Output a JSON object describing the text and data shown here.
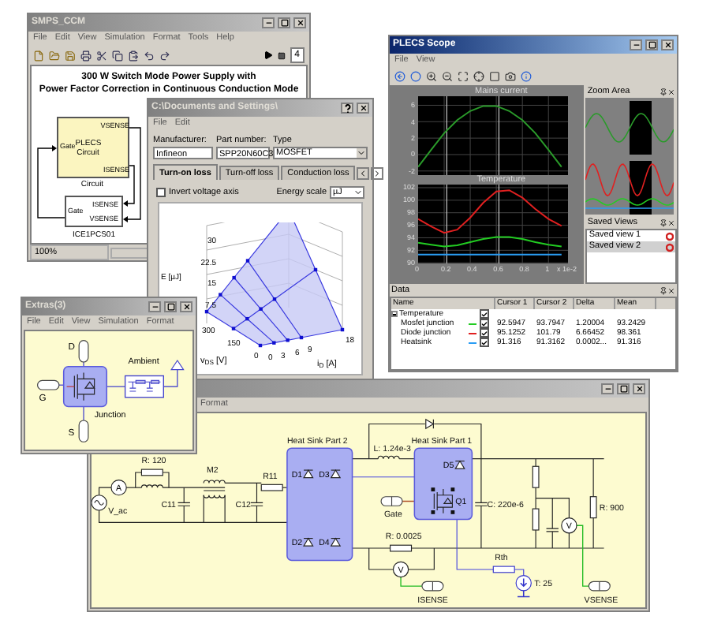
{
  "model_window": {
    "title": "SMPS_CCM",
    "active": false,
    "menu": [
      "File",
      "Edit",
      "View",
      "Simulation",
      "Format",
      "Tools",
      "Help"
    ],
    "step": "4",
    "heading_lines": [
      "300 W Switch Mode Power Supply with",
      "Power Factor Correction in Continuous Conduction Mode"
    ],
    "blocks": [
      {
        "kind": "subsystem",
        "body": "PLECS Circuit",
        "label": "Circuit",
        "port_left": "Gate",
        "ports_right": [
          "VSENSE",
          "ISENSE"
        ]
      },
      {
        "kind": "component",
        "label": "ICE1PCS01",
        "port_left": "Gate",
        "ports_right": [
          "ISENSE",
          "VSENSE"
        ]
      }
    ],
    "status": "100%"
  },
  "loss_window": {
    "title": "C:\\Documents and Settings\\",
    "active": false,
    "menu": [
      "File",
      "Edit"
    ],
    "fields": [
      {
        "kind": "text",
        "label": "Manufacturer:",
        "value": "Infineon"
      },
      {
        "kind": "text",
        "label": "Part number:",
        "value": "SPP20N60C3"
      },
      {
        "kind": "dropdown",
        "label": "Type",
        "value": "MOSFET"
      }
    ],
    "tabs": [
      {
        "label": "Turn-on loss",
        "selected": true
      },
      {
        "label": "Turn-off loss",
        "selected": false
      },
      {
        "label": "Conduction loss",
        "selected": false
      }
    ],
    "invert_axis": {
      "label": "Invert voltage axis",
      "checked": false
    },
    "energy_scale": {
      "label": "Energy scale",
      "value": "µJ"
    },
    "plot": {
      "z_label": "E [µJ]",
      "z_ticks": [
        "30",
        "22.5",
        "15",
        "7.5"
      ],
      "v_label": "v$_{DS}$ [V]",
      "v_ticks": [
        "300",
        "150",
        "0"
      ],
      "i_label": "i$_{D}$ [A]",
      "i_ticks": [
        "0",
        "3",
        "6",
        "9",
        "18"
      ]
    }
  },
  "scope_window": {
    "title": "PLECS Scope",
    "active": true,
    "menu": [
      "File",
      "View"
    ],
    "plots": [
      {
        "chart_data": {
          "type": "line",
          "title": "Mains current",
          "x": [
            0,
            0.1,
            0.2,
            0.3,
            0.4,
            0.5,
            0.6,
            0.7,
            0.8,
            0.9,
            1.0,
            1.1
          ],
          "xlim": [
            0,
            1.15
          ],
          "ylim": [
            -2.5,
            7.1
          ],
          "yticks": [
            -2,
            0,
            2,
            4,
            6
          ],
          "grid": true,
          "ref_lines": [
            {
              "axis": "x",
              "value": 0.22
            },
            {
              "axis": "x",
              "value": 0.62
            }
          ],
          "series": [
            {
              "color": "#2a9a2a",
              "values": [
                -1.5,
                0.6,
                2.6,
                4.2,
                5.3,
                5.9,
                5.9,
                5.3,
                4.2,
                2.6,
                0.6,
                -1.5
              ]
            }
          ]
        }
      },
      {
        "chart_data": {
          "type": "line",
          "title": "Temperature",
          "x": [
            0,
            0.1,
            0.2,
            0.3,
            0.4,
            0.5,
            0.6,
            0.7,
            0.8,
            0.9,
            1.0,
            1.1
          ],
          "xlim": [
            0,
            1.15
          ],
          "ylim": [
            89.9,
            102.5
          ],
          "yticks": [
            90,
            92,
            94,
            96,
            98,
            100,
            102
          ],
          "xticks": [
            0,
            0.2,
            0.4,
            0.6,
            0.8,
            1
          ],
          "xlabel": "x 1e-2",
          "grid": true,
          "ref_lines": [
            {
              "axis": "x",
              "value": 0.22
            },
            {
              "axis": "x",
              "value": 0.62
            }
          ],
          "series": [
            {
              "color": "#22cc22",
              "values": [
                93.2,
                92.9,
                92.6,
                92.8,
                93.3,
                93.8,
                94.1,
                94.1,
                93.8,
                93.3,
                92.9,
                92.6
              ]
            },
            {
              "color": "#e02020",
              "values": [
                97,
                95.8,
                94.8,
                95.3,
                97.2,
                99.6,
                101.4,
                101.6,
                100.4,
                98.6,
                97,
                95.9
              ]
            },
            {
              "color": "#2a9df4",
              "values": [
                91.3,
                91.3,
                91.3,
                91.3,
                91.3,
                91.3,
                91.3,
                91.3,
                91.3,
                91.3,
                91.3,
                91.3
              ]
            }
          ]
        }
      }
    ],
    "zoom_area": {
      "title": "Zoom Area"
    },
    "saved_views": {
      "title": "Saved Views",
      "items": [
        {
          "label": "Saved view 1",
          "selected": false
        },
        {
          "label": "Saved view 2",
          "selected": true
        }
      ]
    },
    "data": {
      "title": "Data",
      "columns": [
        "Name",
        "Cursor 1",
        "Cursor 2",
        "Delta",
        "Mean"
      ],
      "group": {
        "label": "Temperature",
        "checked": true,
        "expanded": true
      },
      "rows": [
        {
          "cells": [
            "Mosfet junction",
            "92.5947",
            "93.7947",
            "1.20004",
            "93.2429"
          ],
          "color": "#22cc22",
          "checked": true
        },
        {
          "cells": [
            "Diode junction",
            "95.1252",
            "101.79",
            "6.66452",
            "98.361"
          ],
          "color": "#e02020",
          "checked": true
        },
        {
          "cells": [
            "Heatsink",
            "91.316",
            "91.3162",
            "0.0002...",
            "91.316"
          ],
          "color": "#2a9df4",
          "checked": true
        }
      ]
    }
  },
  "thermal_window": {
    "title": "Extras(3)",
    "active": false,
    "menu": [
      "File",
      "Edit",
      "View",
      "Simulation",
      "Format"
    ],
    "ports": [
      "D",
      "G",
      "S"
    ],
    "junction": "Junction",
    "ambient": "Ambient"
  },
  "circuit_window": {
    "active": false,
    "menu": [
      "Format"
    ],
    "components": [
      {
        "kind": "source",
        "label": "V_ac"
      },
      {
        "kind": "meter",
        "label": "A"
      },
      {
        "kind": "resistor",
        "label": "R: 120"
      },
      {
        "kind": "inductor"
      },
      {
        "kind": "capacitor",
        "label": "C11"
      },
      {
        "kind": "transformer",
        "label": "M2"
      },
      {
        "kind": "capacitor",
        "label": "C12"
      },
      {
        "kind": "resistor",
        "label": "R11"
      },
      {
        "kind": "heatsink",
        "label": "Heat Sink Part 2",
        "children": [
          {
            "kind": "diode",
            "label": "D1"
          },
          {
            "kind": "diode",
            "label": "D3"
          },
          {
            "kind": "diode",
            "label": "D2"
          },
          {
            "kind": "diode",
            "label": "D4"
          }
        ]
      },
      {
        "kind": "diode"
      },
      {
        "kind": "inductor",
        "label": "L: 1.24e-3"
      },
      {
        "kind": "heatsink",
        "label": "Heat Sink Part 1",
        "children": [
          {
            "kind": "diode",
            "label": "D5"
          },
          {
            "kind": "mosfet",
            "label": "Q1"
          }
        ]
      },
      {
        "kind": "port",
        "label": "Gate"
      },
      {
        "kind": "capacitor",
        "label": "C: 220e-6"
      },
      {
        "kind": "resistor"
      },
      {
        "kind": "resistor"
      },
      {
        "kind": "capacitor"
      },
      {
        "kind": "meter",
        "label": "V"
      },
      {
        "kind": "resistor",
        "label": "R: 900"
      },
      {
        "kind": "resistor",
        "label": "R: 0.0025"
      },
      {
        "kind": "meter",
        "label": "V"
      },
      {
        "kind": "resistor",
        "label": "Rth"
      },
      {
        "kind": "thermal_source",
        "label": "T: 25"
      },
      {
        "kind": "port",
        "label": "ISENSE"
      },
      {
        "kind": "port",
        "label": "VSENSE"
      }
    ]
  }
}
